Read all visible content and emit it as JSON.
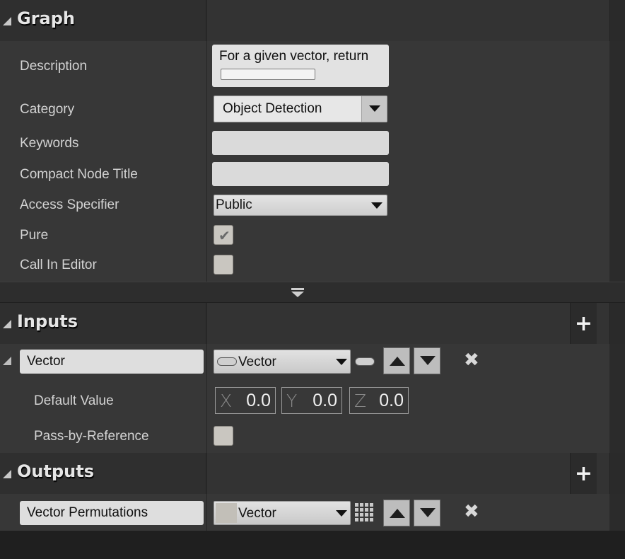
{
  "graph": {
    "title": "Graph",
    "description_label": "Description",
    "description_value": "For a given vector, return",
    "category_label": "Category",
    "category_value": "Object Detection",
    "keywords_label": "Keywords",
    "keywords_value": "",
    "compact_title_label": "Compact Node Title",
    "compact_title_value": "",
    "access_label": "Access Specifier",
    "access_value": "Public",
    "pure_label": "Pure",
    "pure_checked": true,
    "call_in_editor_label": "Call In Editor",
    "call_in_editor_checked": false
  },
  "inputs": {
    "title": "Inputs",
    "add_glyph": "+",
    "param_name": "Vector",
    "param_type": "Vector",
    "default_value_label": "Default Value",
    "x_axis": "X",
    "x_value": "0.0",
    "y_axis": "Y",
    "y_value": "0.0",
    "z_axis": "Z",
    "z_value": "0.0",
    "pass_by_ref_label": "Pass-by-Reference",
    "pass_by_ref_checked": false
  },
  "outputs": {
    "title": "Outputs",
    "add_glyph": "+",
    "param_name": "Vector Permutations",
    "param_type": "Vector"
  },
  "glyphs": {
    "remove": "✖",
    "check": "✔"
  }
}
